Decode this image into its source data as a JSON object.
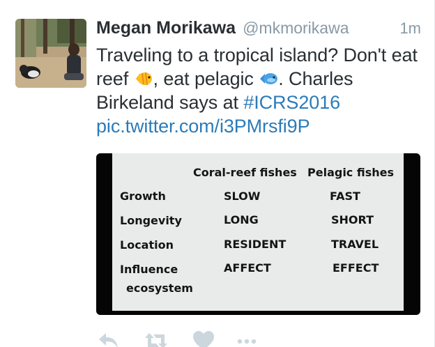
{
  "tweet": {
    "author": {
      "display_name": "Megan Morikawa",
      "screen_name": "@mkmorikawa"
    },
    "timestamp": "1m",
    "text": {
      "part1": "Traveling to a tropical island? Don't eat reef",
      "part2": ", eat pelagic",
      "part3": ". Charles Birkeland says at",
      "hashtag": "#ICRS2016",
      "link": "pic.twitter.com/i3PMrsfi9P"
    },
    "emoji": {
      "reef": "tropical-fish-icon",
      "pelagic": "fish-icon"
    }
  },
  "slide": {
    "column_headers": [
      "Coral-reef fishes",
      "Pelagic fishes"
    ],
    "rows": [
      {
        "label": "Growth",
        "reef": "SLOW",
        "pelagic": "FAST"
      },
      {
        "label": "Longevity",
        "reef": "LONG",
        "pelagic": "SHORT"
      },
      {
        "label": "Location",
        "reef": "RESIDENT",
        "pelagic": "TRAVEL"
      },
      {
        "label": "Influence",
        "label2": "ecosystem",
        "reef": "AFFECT",
        "pelagic": "EFFECT"
      }
    ]
  },
  "actions": [
    "reply-icon",
    "retweet-icon",
    "like-icon",
    "more-icon"
  ],
  "colors": {
    "link": "#2b7bb9",
    "muted": "#8899a6",
    "text": "#292f33",
    "action_icon": "#ccd6dd"
  }
}
